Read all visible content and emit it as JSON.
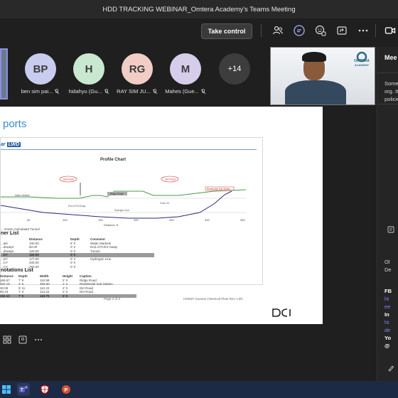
{
  "window": {
    "title": "HDD TRACKING WEBINAR_Omtera Academy's Teams Meeting"
  },
  "toolbar": {
    "take_control_label": "Take control",
    "icons": [
      "people-icon",
      "chat-icon",
      "react-icon",
      "share-tray-icon",
      "more-icon",
      "camera-icon"
    ]
  },
  "participants": [
    {
      "initials": "BP",
      "name": "ben sim pai...",
      "color": "#c9ccee"
    },
    {
      "initials": "H",
      "name": "hidahyu (Gu...",
      "color": "#c9e8d0"
    },
    {
      "initials": "RG",
      "name": "RAY SIM JU...",
      "color": "#f1cdc6"
    },
    {
      "initials": "M",
      "name": "Mahes (Gue...",
      "color": "#d5cdea"
    }
  ],
  "more_participants": "+14",
  "speaker": {
    "logo_text": "OMTERA",
    "logo_sub": "ACADEMY"
  },
  "slide": {
    "title_fragment": "ports",
    "doc_header": "ar",
    "doc_header_badge": "LWD",
    "chart_title": "Profile Chart",
    "x_axis_label": "Distance, ft",
    "x_ticks": [
      "0",
      "50",
      "100",
      "150",
      "200",
      "250",
      "300",
      "350"
    ],
    "annotations": [
      "Dirt Road",
      "Dirt Road",
      "Residential Sub Station",
      "Water Markets",
      "End of Pull Swap",
      "Ridge Road",
      "Hydrogen Line",
      "Zoom On"
    ],
    "legend": "... Green  Calculated Tunnel",
    "section1_title": "ner List",
    "table1_headers": [
      "",
      "Distance",
      "Depth",
      "Comment"
    ],
    "table1_rows": [
      [
        "...ate",
        "100.00",
        "6' 0",
        "Water Markets"
      ],
      [
        "...dswept",
        "60.00",
        "0' 2",
        "End of Pull 8 Swap"
      ],
      [
        "...dswept",
        "120.00",
        "0' 0",
        "Tunnel"
      ],
      [
        "...DY",
        "150.00",
        "0' 0",
        ""
      ],
      [
        "...DY",
        "177.00",
        "0' 2",
        "Hydrogen Line"
      ],
      [
        "...CY",
        "200.00",
        "0' 0",
        ""
      ],
      [
        "...CY",
        "250.00",
        "0' 0",
        ""
      ]
    ],
    "section2_title": "notations List",
    "table2_headers": [
      "Distance",
      "Depth",
      "Width",
      "Height",
      "Caption"
    ],
    "table2_rows": [
      [
        "165.67",
        "7' 9",
        "110.99",
        "2' 0",
        "Ridge Road"
      ],
      [
        "202.19",
        "4' 5",
        "306.50",
        "1' 4",
        "Residential Sub Station"
      ],
      [
        "30.08",
        "8' 11",
        "112.22",
        "2' 0",
        "Dirt Road"
      ],
      [
        "80.23",
        "7' 3",
        "114.22",
        "2' 0",
        "Dirt Road"
      ],
      [
        "104.10",
        "7' 9",
        "118.70",
        "6' 8",
        ""
      ]
    ],
    "footer_page": "Page 2 of 3",
    "footer_doc": "H20827 Kansas Chemical Plant Rev 1.0f1",
    "brand_mark": "DCI"
  },
  "panel": {
    "title": "Mee",
    "intro_lines": [
      "Some",
      "org. It",
      "policie"
    ],
    "chat_lines": [
      "Ol",
      "De"
    ],
    "link_lines": [
      "ht",
      "ee",
      "ht",
      "de"
    ],
    "label_fb": "FB",
    "label_in": "In",
    "label_yo": "Yo",
    "label_at": "@"
  },
  "stage_bottom_icons": [
    "grid-icon",
    "people-view-icon",
    "more-icon"
  ],
  "taskbar_apps": [
    "start-icon",
    "teams-icon",
    "security-icon",
    "powerpoint-icon"
  ]
}
